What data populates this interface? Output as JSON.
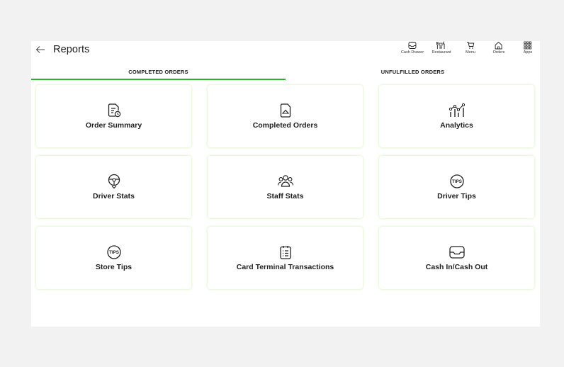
{
  "header": {
    "title": "Reports",
    "back_icon": "arrow-left-icon"
  },
  "nav": [
    {
      "label": "Cash Drawer",
      "icon": "cash-drawer-icon"
    },
    {
      "label": "Restaurant",
      "icon": "restaurant-icon"
    },
    {
      "label": "Menu",
      "icon": "cart-icon"
    },
    {
      "label": "Orders",
      "icon": "home-icon"
    },
    {
      "label": "Apps",
      "icon": "apps-grid-icon"
    }
  ],
  "tabs": [
    {
      "label": "COMPLETED ORDERS",
      "active": true
    },
    {
      "label": "UNFULFILLED ORDERS",
      "active": false
    }
  ],
  "accent_color": "#2bb52b",
  "cards": [
    {
      "label": "Order Summary",
      "icon": "order-summary-icon"
    },
    {
      "label": "Completed Orders",
      "icon": "completed-orders-icon"
    },
    {
      "label": "Analytics",
      "icon": "analytics-icon"
    },
    {
      "label": "Driver Stats",
      "icon": "steering-wheel-icon"
    },
    {
      "label": "Staff Stats",
      "icon": "staff-icon"
    },
    {
      "label": "Driver Tips",
      "icon": "tips-icon"
    },
    {
      "label": "Store Tips",
      "icon": "tips-icon"
    },
    {
      "label": "Card Terminal Transactions",
      "icon": "clipboard-list-icon"
    },
    {
      "label": "Cash In/Cash Out",
      "icon": "cash-drawer-icon"
    }
  ]
}
